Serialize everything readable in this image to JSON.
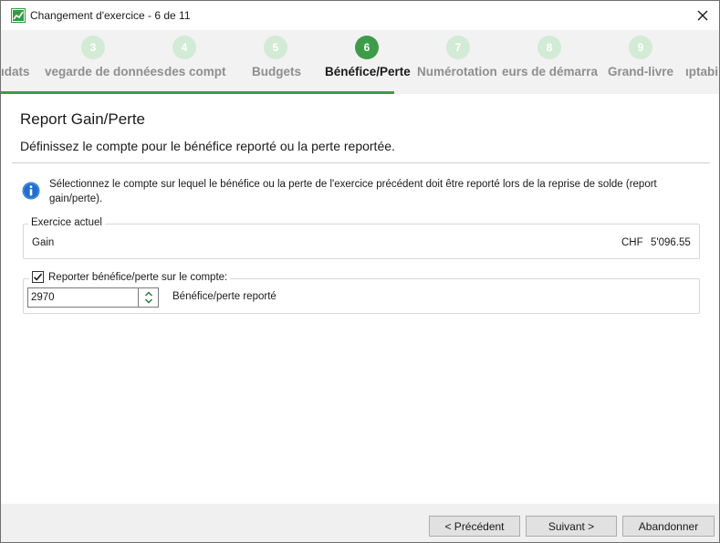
{
  "window": {
    "title": "Changement d'exercice - 6 de 11"
  },
  "stepper": {
    "steps": [
      {
        "number": "",
        "label": "ıdats"
      },
      {
        "number": "3",
        "label": "vegarde de données"
      },
      {
        "number": "",
        "label": "des compt"
      },
      {
        "number": "4",
        "label": ""
      },
      {
        "number": "5",
        "label": "Budgets"
      },
      {
        "number": "6",
        "label": "Bénéfice/Perte"
      },
      {
        "number": "7",
        "label": "Numérotation"
      },
      {
        "number": "8",
        "label": "eurs de démarra"
      },
      {
        "number": "9",
        "label": "Grand-livre"
      },
      {
        "number": "",
        "label": "ıptabi"
      }
    ]
  },
  "page": {
    "heading": "Report Gain/Perte",
    "subheading": "Définissez le compte pour le bénéfice reporté ou la perte reportée.",
    "info": "Sélectionnez le compte sur lequel le bénéfice ou la perte de l'exercice précédent doit être reporté lors de la reprise de solde (report gain/perte)."
  },
  "current_year": {
    "legend": "Exercice actuel",
    "result_label": "Gain",
    "currency": "CHF",
    "amount": "5'096.55"
  },
  "carry_forward": {
    "checkbox_label": "Reporter bénéfice/perte sur le compte:",
    "checked": true,
    "account_number": "2970",
    "account_name": "Bénéfice/perte reporté"
  },
  "footer": {
    "prev_label": "< Précédent",
    "next_label": "Suivant >",
    "cancel_label": "Abandonner"
  },
  "colors": {
    "accent": "#3d9c4a",
    "inactive_step": "#d2ebd5",
    "footer_bg": "#f0f0f0"
  }
}
